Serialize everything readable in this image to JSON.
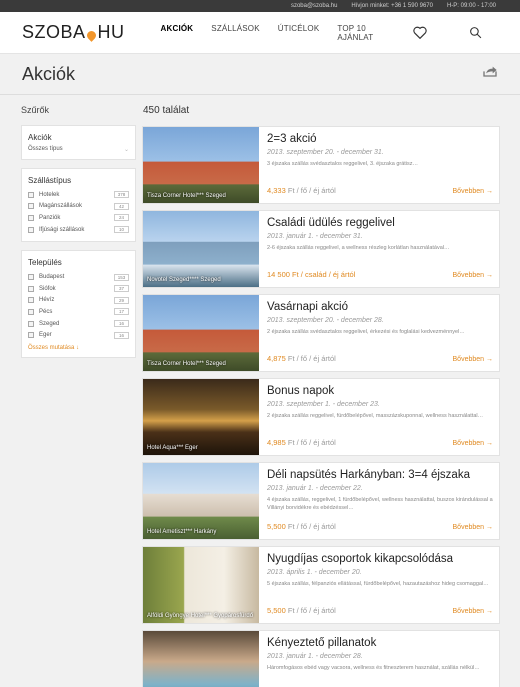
{
  "topbar": {
    "email": "szoba@szoba.hu",
    "about": "Hívjon minket: +36 1 590 9670",
    "hours": "H-P: 09:00 - 17:00"
  },
  "header": {
    "logo_left": "SZOBA",
    "logo_right": "HU",
    "nav": [
      "AKCIÓK",
      "SZÁLLÁSOK",
      "ÚTICÉLOK",
      "TOP 10 AJÁNLAT"
    ],
    "active_nav": "AKCIÓK"
  },
  "page": {
    "title": "Akciók"
  },
  "sidebar": {
    "title": "Szűrők",
    "akciok_box": {
      "heading": "Akciók",
      "select_value": "Összes típus"
    },
    "type_box": {
      "heading": "Szállástípus",
      "options": [
        {
          "label": "Hotelek",
          "count": "378"
        },
        {
          "label": "Magánszállások",
          "count": "42"
        },
        {
          "label": "Panziók",
          "count": "24"
        },
        {
          "label": "Ifjúsági szállások",
          "count": "10"
        }
      ]
    },
    "place_box": {
      "heading": "Település",
      "options": [
        {
          "label": "Budapest",
          "count": "153"
        },
        {
          "label": "Siófok",
          "count": "37"
        },
        {
          "label": "Hévíz",
          "count": "29"
        },
        {
          "label": "Pécs",
          "count": "17"
        },
        {
          "label": "Szeged",
          "count": "16"
        },
        {
          "label": "Eger",
          "count": "16"
        }
      ],
      "more": "Összes mutatása ↓"
    }
  },
  "results": {
    "count": "450 találat",
    "items": [
      {
        "title": "2=3 akció",
        "date": "2013. szeptember 20. - december 31.",
        "desc": "3 éjszaka szállás svédasztalos reggelivel, 3. éjszaka grátisz…",
        "price": "4,333",
        "unit": "Ft / fő / éj ártól",
        "button": "Bővebben →",
        "caption": "Tisza Corner Hotel*** Szeged"
      },
      {
        "title": "Családi üdülés reggelivel",
        "date": "2013. január 1. - december 31.",
        "desc": "2-6 éjszaka szállás reggelivel, a wellness részleg korlátlan használatával…",
        "price": "14 500 Ft / család / éj ártól",
        "unit": "",
        "button": "Bővebben →",
        "caption": "Novotel Szeged**** Szeged"
      },
      {
        "title": "Vasárnapi akció",
        "date": "2013. szeptember 20. - december 28.",
        "desc": "2 éjszaka szállás svédasztalos reggelivel, érkezési és foglalási kedvezménnyel…",
        "price": "4,875",
        "unit": "Ft / fő / éj ártól",
        "button": "Bővebben →",
        "caption": "Tisza Corner Hotel*** Szeged"
      },
      {
        "title": "Bonus napok",
        "date": "2013. szeptember 1. - december 23.",
        "desc": "2 éjszaka szállás reggelivel, fürdőbelépővel, masszázskuponnal, wellness használattal…",
        "price": "4,985",
        "unit": "Ft / fő / éj ártól",
        "button": "Bővebben →",
        "caption": "Hotel Aqua*** Eger"
      },
      {
        "title": "Déli napsütés Harkányban: 3=4 éjszaka",
        "date": "2013. január 1. - december 22.",
        "desc": "4 éjszaka szállás, reggelivel, 1 fürdőbelépővel, wellness használattal, buszos kirándulással a Villányi borvidékre és ebédzéssel…",
        "price": "5,500",
        "unit": "Ft / fő / éj ártól",
        "button": "Bővebben →",
        "caption": "Hotel Ametiszt*** Harkány"
      },
      {
        "title": "Nyugdíjas csoportok kikapcsolódása",
        "date": "2013. április 1. - december 20.",
        "desc": "5 éjszaka szállás, félpanziós ellátással, fürdőbelépővel, hazautazáshoz hideg csomaggal…",
        "price": "5,500",
        "unit": "Ft / fő / éj ártól",
        "button": "Bővebben →",
        "caption": "Alföldi Gyöngye Hotel*** Gyopárosfürdő"
      },
      {
        "title": "Kényeztető pillanatok",
        "date": "2013. január 1. - december 28.",
        "desc": "Háromfogásos ebéd vagy vacsora, wellness és fitneszterem használat, szállás nélkül…",
        "price": "",
        "unit": "",
        "button": "",
        "caption": ""
      }
    ]
  }
}
